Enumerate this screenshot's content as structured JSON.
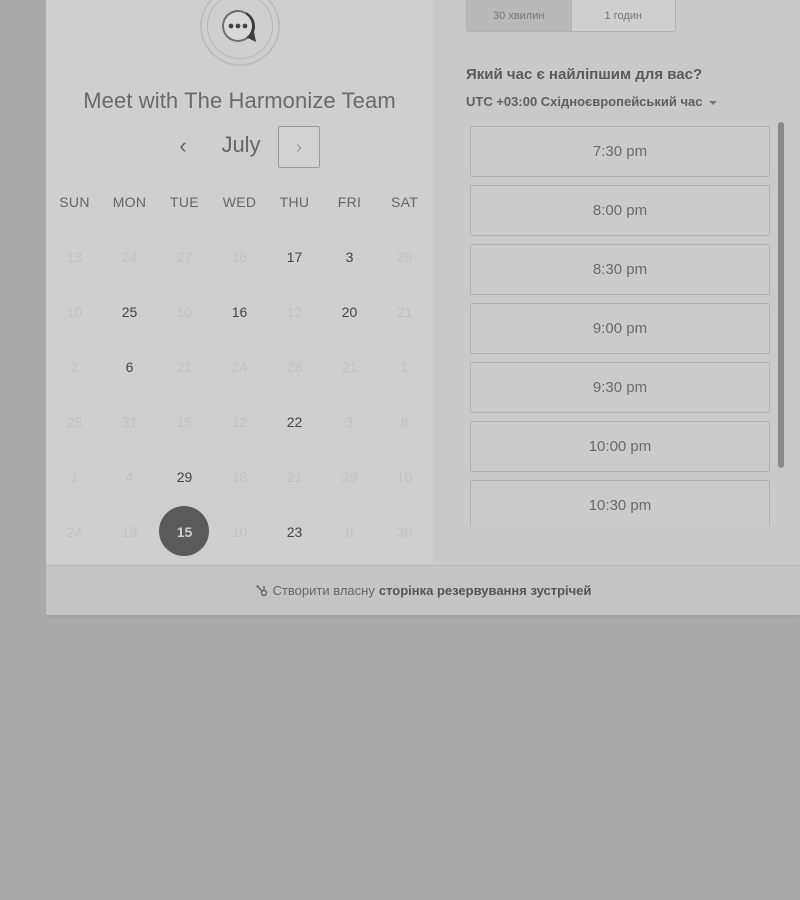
{
  "duration_tabs": [
    {
      "label": "30 хвилин",
      "active": true
    },
    {
      "label": "1 годин",
      "active": false
    }
  ],
  "title": "Meet with The Harmonize Team",
  "calendar": {
    "month": "July",
    "prev_label": "‹",
    "next_label": "›",
    "weekdays": [
      "SUN",
      "MON",
      "TUE",
      "WED",
      "THU",
      "FRI",
      "SAT"
    ],
    "weeks": [
      [
        {
          "d": "13",
          "a": false
        },
        {
          "d": "24",
          "a": false
        },
        {
          "d": "27",
          "a": false
        },
        {
          "d": "16",
          "a": false
        },
        {
          "d": "17",
          "a": true
        },
        {
          "d": "3",
          "a": true
        },
        {
          "d": "28",
          "a": false
        }
      ],
      [
        {
          "d": "10",
          "a": false
        },
        {
          "d": "25",
          "a": true
        },
        {
          "d": "10",
          "a": false
        },
        {
          "d": "16",
          "a": true
        },
        {
          "d": "12",
          "a": false
        },
        {
          "d": "20",
          "a": true
        },
        {
          "d": "21",
          "a": false
        }
      ],
      [
        {
          "d": "2",
          "a": false
        },
        {
          "d": "6",
          "a": true
        },
        {
          "d": "21",
          "a": false
        },
        {
          "d": "24",
          "a": false
        },
        {
          "d": "28",
          "a": false
        },
        {
          "d": "21",
          "a": false
        },
        {
          "d": "1",
          "a": false
        }
      ],
      [
        {
          "d": "28",
          "a": false
        },
        {
          "d": "31",
          "a": false
        },
        {
          "d": "15",
          "a": false
        },
        {
          "d": "12",
          "a": false
        },
        {
          "d": "22",
          "a": true
        },
        {
          "d": "3",
          "a": false
        },
        {
          "d": "8",
          "a": false
        }
      ],
      [
        {
          "d": "1",
          "a": false
        },
        {
          "d": "4",
          "a": false
        },
        {
          "d": "29",
          "a": true
        },
        {
          "d": "18",
          "a": false
        },
        {
          "d": "21",
          "a": false
        },
        {
          "d": "29",
          "a": false
        },
        {
          "d": "10",
          "a": false
        }
      ],
      [
        {
          "d": "24",
          "a": false
        },
        {
          "d": "19",
          "a": false
        },
        {
          "d": "15",
          "a": true,
          "selected": true
        },
        {
          "d": "10",
          "a": false
        },
        {
          "d": "23",
          "a": true
        },
        {
          "d": "8",
          "a": false
        },
        {
          "d": "30",
          "a": false
        }
      ]
    ]
  },
  "question": "Який час є найліпшим для вас?",
  "timezone": "UTC +03:00 Східноєвропейський час",
  "time_slots": [
    "7:30 pm",
    "8:00 pm",
    "8:30 pm",
    "9:00 pm",
    "9:30 pm",
    "10:00 pm",
    "10:30 pm"
  ],
  "footer": {
    "prefix": "Створити власну",
    "strong": "сторінка резервування зустрічей"
  },
  "colors": {
    "background": "#aaaaaa",
    "selected_day": "#5a5a5a"
  }
}
